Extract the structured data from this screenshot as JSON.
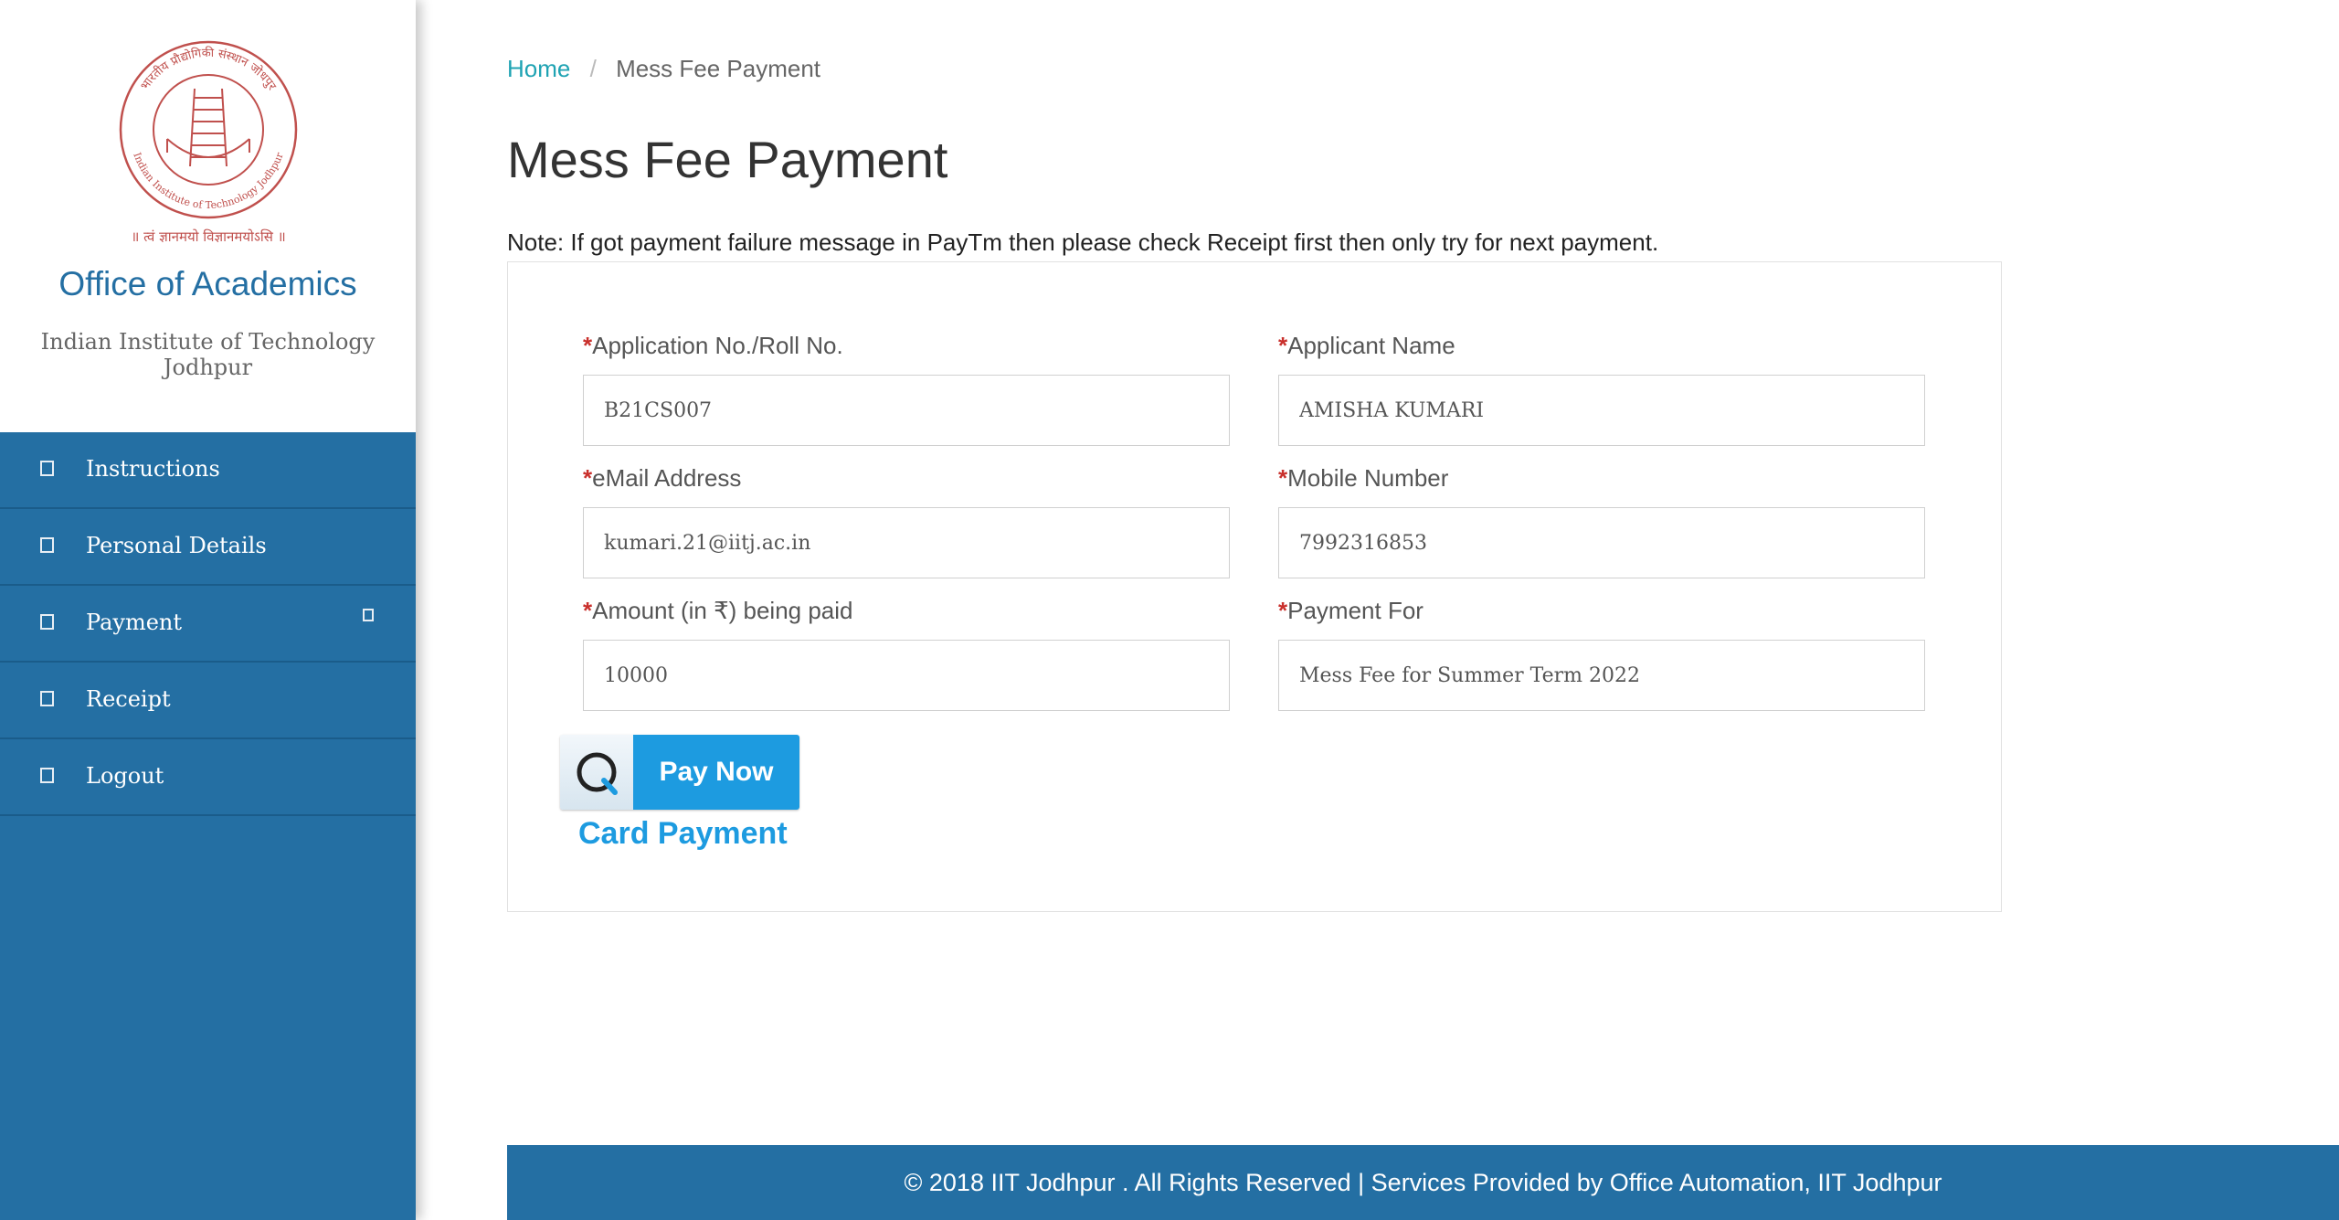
{
  "sidebar": {
    "logo": {
      "ring_text_top": "भारतीय प्रौद्योगिकी संस्थान जोधपुर",
      "ring_text_bottom": "Indian Institute of Technology Jodhpur",
      "motto": "॥ त्वं ज्ञानमयो विज्ञानमयोऽसि ॥",
      "color": "#c0504d"
    },
    "office_title": "Office of Academics",
    "institute_name": "Indian Institute of Technology Jodhpur",
    "items": [
      {
        "label": "Instructions",
        "icon": "square-icon"
      },
      {
        "label": "Personal Details",
        "icon": "square-icon"
      },
      {
        "label": "Payment",
        "icon": "square-icon",
        "expand_icon": "chevron-icon"
      },
      {
        "label": "Receipt",
        "icon": "square-icon"
      },
      {
        "label": "Logout",
        "icon": "square-icon"
      }
    ]
  },
  "breadcrumb": {
    "home": "Home",
    "separator": "/",
    "current": "Mess Fee Payment"
  },
  "page_title": "Mess Fee Payment",
  "note": "Note: If got payment failure message in PayTm then please check Receipt first then only try for next payment.",
  "form": {
    "required_marker": "*",
    "application_no": {
      "label": "Application No./Roll No.",
      "value": "B21CS007"
    },
    "applicant_name": {
      "label": "Applicant Name",
      "value": "AMISHA KUMARI"
    },
    "email": {
      "label": "eMail Address",
      "value": "kumari.21@iitj.ac.in"
    },
    "mobile": {
      "label": "Mobile Number",
      "value": "7992316853"
    },
    "amount": {
      "label": "Amount (in ₹) being paid",
      "value": "10000"
    },
    "payment_for": {
      "label": "Payment For",
      "value": "Mess Fee for Summer Term 2022"
    }
  },
  "pay_button": {
    "label": "Pay Now",
    "icon": "paytm-q-icon"
  },
  "card_payment_label": "Card Payment",
  "footer": {
    "text": "© 2018 IIT Jodhpur . All Rights Reserved | Services Provided by Office Automation, IIT Jodhpur"
  },
  "colors": {
    "sidebar_bg": "#246fa3",
    "link": "#1fa3b3",
    "pay_button": "#1d9be0",
    "required": "#c9302c"
  }
}
